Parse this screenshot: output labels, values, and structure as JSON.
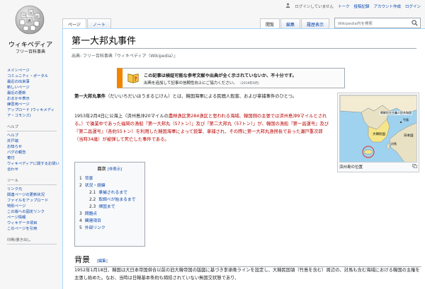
{
  "logo": {
    "wordmark": "ウィキペディア",
    "tagline": "フリー百科事典"
  },
  "personal": {
    "not_logged_in": "ログインしていません",
    "talk": "トーク",
    "contributions": "投稿記録",
    "create_account": "アカウント作成",
    "login": "ログイン"
  },
  "tabs_left": [
    "ページ",
    "ノート"
  ],
  "tabs_right": [
    "閲覧",
    "編集",
    "履歴表示"
  ],
  "search": {
    "placeholder": "Wikipedia内を検索"
  },
  "sidebar": {
    "main": [
      "メインページ",
      "コミュニティ・ポータル",
      "最近の出来事",
      "新しいページ",
      "最近の更新",
      "おまかせ表示",
      "練習用ページ",
      "アップロード (ウィキメディア・コモンズ)"
    ],
    "help_heading": "ヘルプ",
    "help": [
      "ヘルプ",
      "井戸端",
      "お知らせ",
      "バグの報告",
      "寄付",
      "ウィキペディアに関するお問い合わせ"
    ],
    "tools_heading": "ツール",
    "tools": [
      "リンク元",
      "関連ページの更新状況",
      "ファイルをアップロード",
      "特別ページ",
      "この版への固定リンク",
      "ページ情報",
      "ウィキデータ項目",
      "このページを引用"
    ],
    "print_heading": "印刷/書き出し"
  },
  "article": {
    "title": "第一大邦丸事件",
    "subtitle": "出典: フリー百科事典『ウィキペディア（Wikipedia）』",
    "ambox_line1": "この記事は検証可能な参考文献や出典が全く示されていないか、不十分です。",
    "ambox_line2": "出典を追加して記事の信頼性向上にご協力ください。",
    "ambox_date": "（2019年9月）",
    "lead1_bold": "第一大邦丸事件",
    "lead1_rest": "（だいいちだいほうまるじけん）とは、韓国海軍による民間人殺害、および拿捕事件のひとつ。",
    "lead2_a": "1953年2月4日に公海上（済州島沖20マイルの",
    "lead2_b": "農林漁区第284漁区と思われる海域、韓国側の主張では済州島沖9マイルとされる。）で操業中であった福岡の漁船『第一大邦丸（57トン）』及び『第二大邦丸（57トン）』が、韓国の漁船『第一昌運号』及び『第二昌運号』（各約55トン）を利用した韓国海軍によって銃撃、拿捕され、その際に第一大邦丸漁撈長であった瀬戸重次郎（当時34歳）が被弾して死亡した事件である。",
    "toc_title": "目次",
    "toc_toggle": "[非表示]",
    "toc": [
      {
        "num": "1",
        "label": "背景",
        "sub": false
      },
      {
        "num": "2",
        "label": "状況・経緯",
        "sub": false
      },
      {
        "num": "2.1",
        "label": "拿捕されるまで",
        "sub": true
      },
      {
        "num": "2.2",
        "label": "取調べが始まるまで",
        "sub": true
      },
      {
        "num": "2.3",
        "label": "帰国まで",
        "sub": true
      },
      {
        "num": "3",
        "label": "問題点",
        "sub": false
      },
      {
        "num": "4",
        "label": "関連項目",
        "sub": false
      },
      {
        "num": "5",
        "label": "外部リンク",
        "sub": false
      }
    ],
    "infobox_caption": "済州島の位置",
    "map_labels": {
      "north": "朝鮮民主主義人民共和国",
      "south": "大韓民国",
      "japan": "日本国",
      "takeshima": "竹島",
      "tsushima": "対馬"
    },
    "section_heading": "背景",
    "section_edit": "編集",
    "section_para": "1952年1月18日、韓国は大日本帝国併合以前の旧大韓帝国の版図に基づき李承晩ラインを設定し、大韓民国領（竹島を含む）周辺の、対馬も含む海域における韓国の主権を主張し始めた。なお、当時は日韓基本条約も締結されていない無国交状態であり、"
  }
}
